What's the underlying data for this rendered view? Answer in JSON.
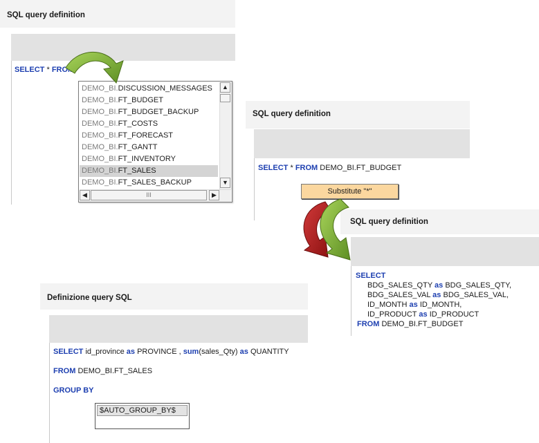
{
  "panel1": {
    "title": "SQL query definition",
    "sql_select": "SELECT",
    "sql_star": " * ",
    "sql_from": "FROM",
    "dropdown": {
      "items": [
        {
          "prefix": "DEMO_BI.",
          "name": "DISCUSSION_MESSAGES"
        },
        {
          "prefix": "DEMO_BI.",
          "name": "FT_BUDGET"
        },
        {
          "prefix": "DEMO_BI.",
          "name": "FT_BUDGET_BACKUP"
        },
        {
          "prefix": "DEMO_BI.",
          "name": "FT_COSTS"
        },
        {
          "prefix": "DEMO_BI.",
          "name": "FT_FORECAST"
        },
        {
          "prefix": "DEMO_BI.",
          "name": "FT_GANTT"
        },
        {
          "prefix": "DEMO_BI.",
          "name": "FT_INVENTORY"
        },
        {
          "prefix": "DEMO_BI.",
          "name": "FT_SALES"
        },
        {
          "prefix": "DEMO_BI.",
          "name": "FT_SALES_BACKUP"
        }
      ],
      "selected_index": 7,
      "hscroll_thumb": "III"
    }
  },
  "panel2": {
    "title": "SQL query definition",
    "sql_select": "SELECT",
    "sql_star": " * ",
    "sql_from": "FROM",
    "sql_table": " DEMO_BI.FT_BUDGET",
    "substitute_label": "Substitute \"*\""
  },
  "panel3": {
    "title": "SQL query definition",
    "sql_select": "SELECT",
    "lines": [
      {
        "col": "BDG_SALES_QTY",
        "as": "as",
        "alias": "BDG_SALES_QTY,"
      },
      {
        "col": "BDG_SALES_VAL",
        "as": "as",
        "alias": "BDG_SALES_VAL,"
      },
      {
        "col": "ID_MONTH",
        "as": "as",
        "alias": "ID_MONTH,"
      },
      {
        "col": "ID_PRODUCT",
        "as": "as",
        "alias": "ID_PRODUCT"
      }
    ],
    "sql_from": "FROM",
    "sql_table": " DEMO_BI.FT_BUDGET"
  },
  "panel4": {
    "title": "Definizione query SQL",
    "select_kw": "SELECT",
    "select_text1": " id_province ",
    "as1": "as",
    "select_text2": " PROVINCE , ",
    "sum_kw": "sum",
    "select_text3": "(sales_Qty) ",
    "as2": "as",
    "select_text4": " QUANTITY",
    "from_kw": "FROM",
    "from_table": " DEMO_BI.FT_SALES",
    "group_kw": "GROUP BY",
    "auto_group": "$AUTO_GROUP_BY$"
  },
  "colors": {
    "keyword": "#1d3fb0",
    "arrow_green": "#8cbf3f",
    "arrow_red": "#b01e1e",
    "substitute_bg": "#fbd79f",
    "selection": "#d4d4d4"
  }
}
